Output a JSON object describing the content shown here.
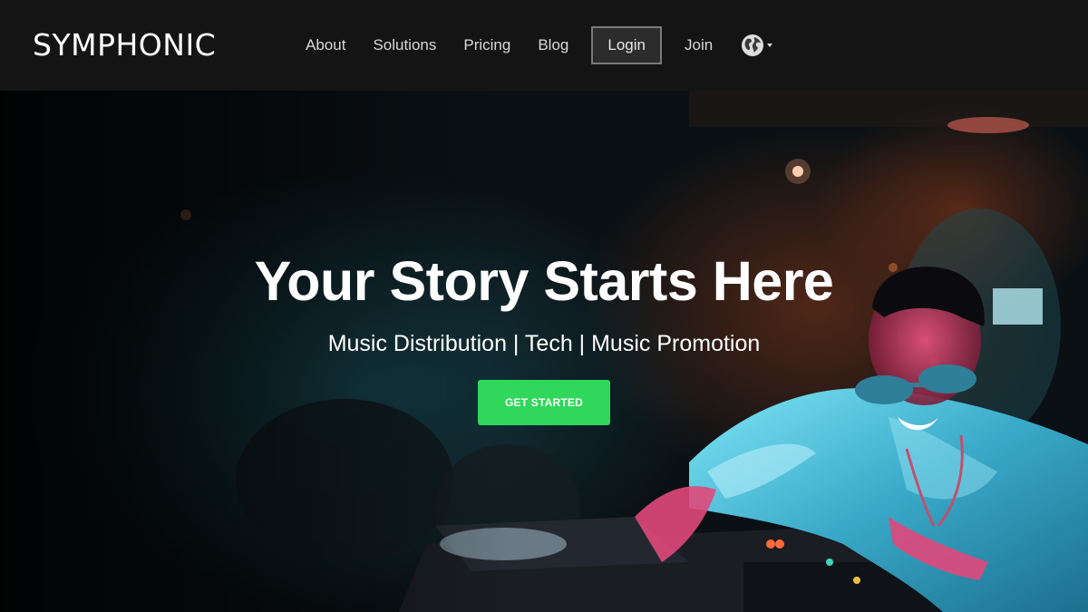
{
  "header": {
    "logo_text": "SYMPHONIC",
    "nav": {
      "about": "About",
      "solutions": "Solutions",
      "pricing": "Pricing",
      "blog": "Blog",
      "login": "Login",
      "join": "Join"
    },
    "language_icon": "globe-icon"
  },
  "hero": {
    "title": "Your Story Starts Here",
    "subtitle": "Music Distribution | Tech | Music Promotion",
    "cta_label": "GET STARTED",
    "background_image": "dj-performing-photo"
  },
  "colors": {
    "header_bg": "#141414",
    "cta_green": "#2fd85a",
    "text_light": "#ffffff"
  }
}
